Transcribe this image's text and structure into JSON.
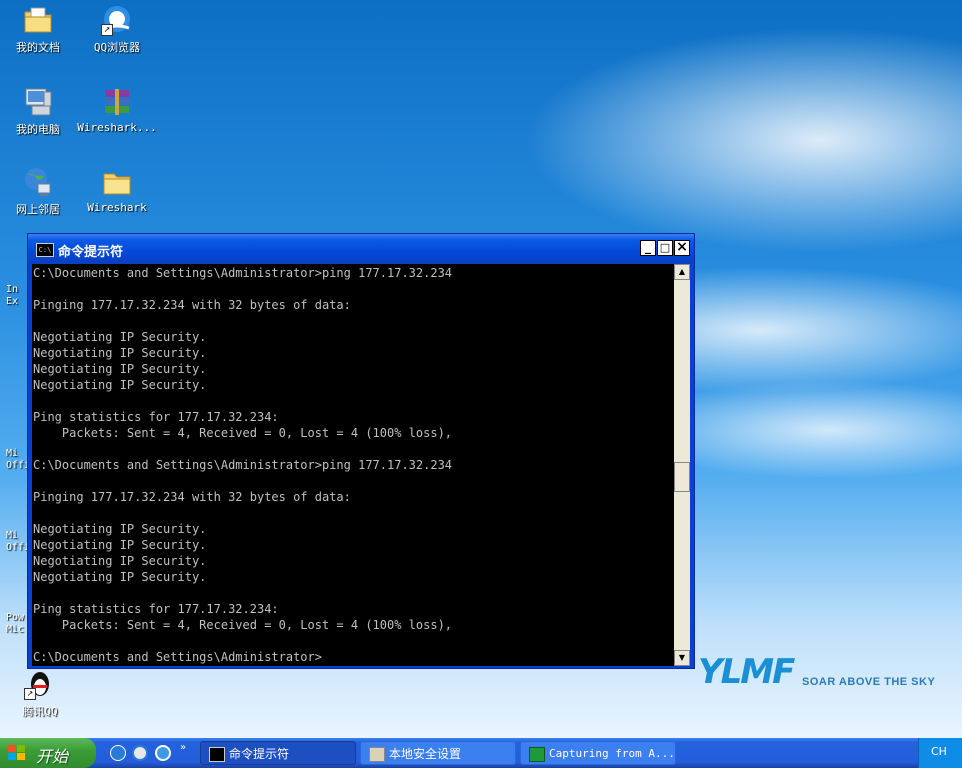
{
  "desktop": {
    "icons": [
      {
        "label": "我的文档",
        "icon": "my-documents-icon"
      },
      {
        "label": "QQ浏览器",
        "icon": "qq-browser-icon"
      },
      {
        "label": "我的电脑",
        "icon": "my-computer-icon"
      },
      {
        "label": "Wireshark...",
        "icon": "winrar-archive-icon"
      },
      {
        "label": "网上邻居",
        "icon": "network-places-icon"
      },
      {
        "label": "Wireshark",
        "icon": "folder-icon"
      },
      {
        "label": "腾讯QQ",
        "icon": "tencent-qq-icon"
      }
    ],
    "partial_icons": [
      {
        "label": "In\nEx"
      },
      {
        "label": "Mi\nOffi"
      },
      {
        "label": "Mi\nOffi"
      },
      {
        "label": "Pow\nMic"
      }
    ],
    "brand": {
      "logo": "YLMF",
      "tagline": "SOAR ABOVE THE SKY"
    }
  },
  "console_window": {
    "title": "命令提示符",
    "icon_text": "C:\\",
    "buttons": {
      "minimize": "_",
      "maximize": "□",
      "close": "×"
    },
    "lines": [
      "C:\\Documents and Settings\\Administrator>ping 177.17.32.234",
      "",
      "Pinging 177.17.32.234 with 32 bytes of data:",
      "",
      "Negotiating IP Security.",
      "Negotiating IP Security.",
      "Negotiating IP Security.",
      "Negotiating IP Security.",
      "",
      "Ping statistics for 177.17.32.234:",
      "    Packets: Sent = 4, Received = 0, Lost = 4 (100% loss),",
      "",
      "C:\\Documents and Settings\\Administrator>ping 177.17.32.234",
      "",
      "Pinging 177.17.32.234 with 32 bytes of data:",
      "",
      "Negotiating IP Security.",
      "Negotiating IP Security.",
      "Negotiating IP Security.",
      "Negotiating IP Security.",
      "",
      "Ping statistics for 177.17.32.234:",
      "    Packets: Sent = 4, Received = 0, Lost = 4 (100% loss),",
      "",
      "C:\\Documents and Settings\\Administrator>"
    ]
  },
  "taskbar": {
    "start_label": "开始",
    "tasks": [
      {
        "label": "命令提示符",
        "icon": "console-icon"
      },
      {
        "label": "本地安全设置",
        "icon": "security-settings-icon"
      },
      {
        "label": "Capturing from A...",
        "icon": "wireshark-icon"
      }
    ],
    "tray": {
      "language": "CH"
    }
  },
  "colors": {
    "titlebar": "#0a5be5",
    "taskbar": "#245edb",
    "start_button": "#3b9e38",
    "console_text": "#c0c0c0"
  }
}
